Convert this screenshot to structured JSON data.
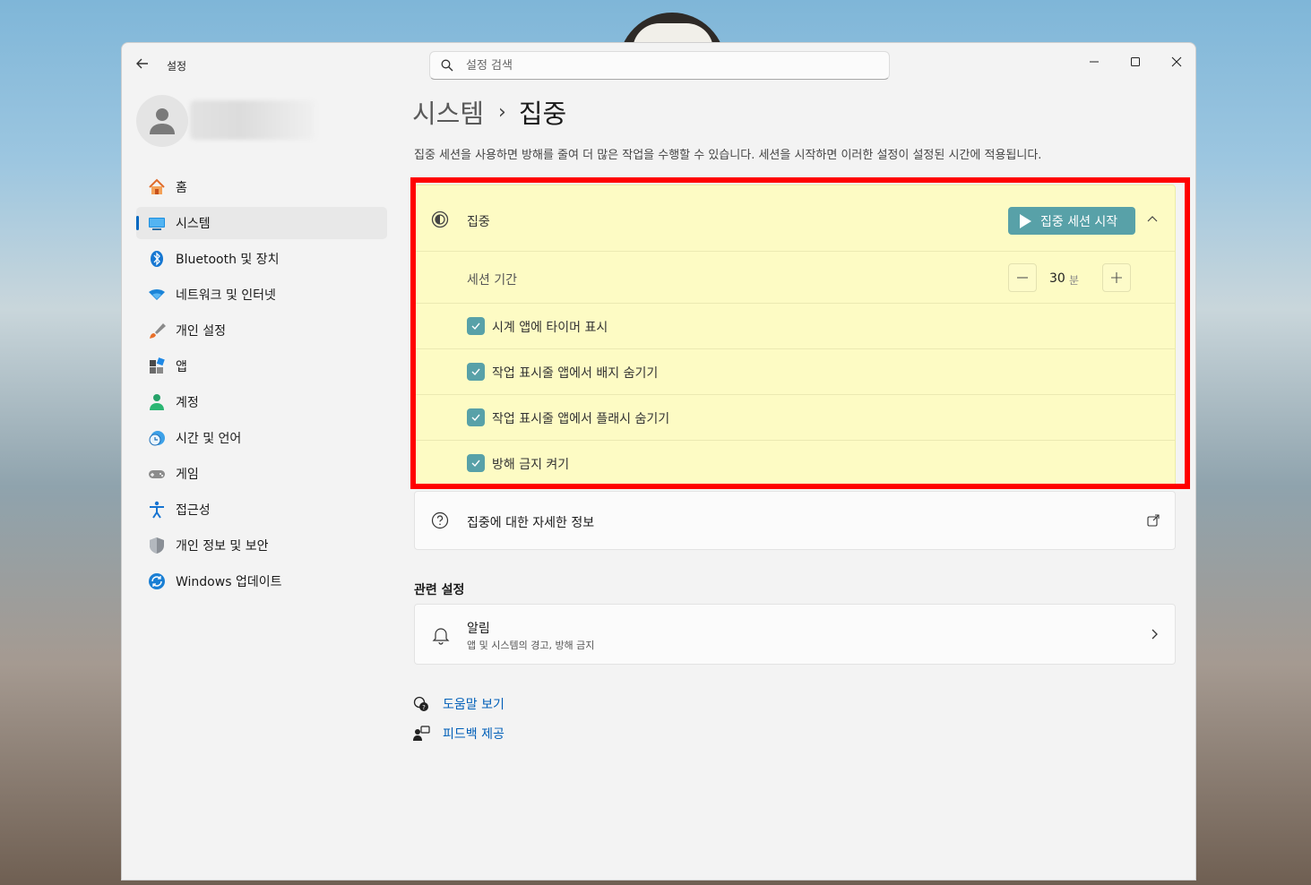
{
  "window": {
    "app_title": "설정",
    "search_placeholder": "설정 검색",
    "controls": [
      "minimize",
      "maximize",
      "close"
    ]
  },
  "sidebar": {
    "items": [
      {
        "label": "홈",
        "icon": "home-icon"
      },
      {
        "label": "시스템",
        "icon": "system-icon",
        "active": true
      },
      {
        "label": "Bluetooth 및 장치",
        "icon": "bluetooth-icon"
      },
      {
        "label": "네트워크 및 인터넷",
        "icon": "wifi-icon"
      },
      {
        "label": "개인 설정",
        "icon": "brush-icon"
      },
      {
        "label": "앱",
        "icon": "apps-icon"
      },
      {
        "label": "계정",
        "icon": "account-icon"
      },
      {
        "label": "시간 및 언어",
        "icon": "clock-globe-icon"
      },
      {
        "label": "게임",
        "icon": "gamepad-icon"
      },
      {
        "label": "접근성",
        "icon": "accessibility-icon"
      },
      {
        "label": "개인 정보 및 보안",
        "icon": "shield-icon"
      },
      {
        "label": "Windows 업데이트",
        "icon": "update-icon"
      }
    ]
  },
  "main": {
    "breadcrumb_parent": "시스템",
    "breadcrumb_separator": "›",
    "breadcrumb_current": "집중",
    "description": "집중 세션을 사용하면 방해를 줄여 더 많은 작업을 수행할 수 있습니다. 세션을 시작하면 이러한 설정이 설정된 시간에 적용됩니다.",
    "focus": {
      "title": "집중",
      "start_button": "집중 세션 시작",
      "session_label": "세션 기간",
      "duration_value": "30",
      "duration_unit": "분",
      "checks": [
        {
          "label": "시계 앱에 타이머 표시",
          "checked": true
        },
        {
          "label": "작업 표시줄 앱에서 배지 숨기기",
          "checked": true
        },
        {
          "label": "작업 표시줄 앱에서 플래시 숨기기",
          "checked": true
        },
        {
          "label": "방해 금지 켜기",
          "checked": true
        }
      ]
    },
    "info_link": "집중에 대한 자세한 정보",
    "related_title": "관련 설정",
    "notifications": {
      "title": "알림",
      "subtitle": "앱 및 시스템의 경고, 방해 금지"
    },
    "help_label": "도움말 보기",
    "feedback_label": "피드백 제공"
  },
  "colors": {
    "accent": "#58a1a8",
    "highlight_box": "#ff0000",
    "focus_card_bg": "#fdfbc4",
    "link": "#005fb8"
  }
}
